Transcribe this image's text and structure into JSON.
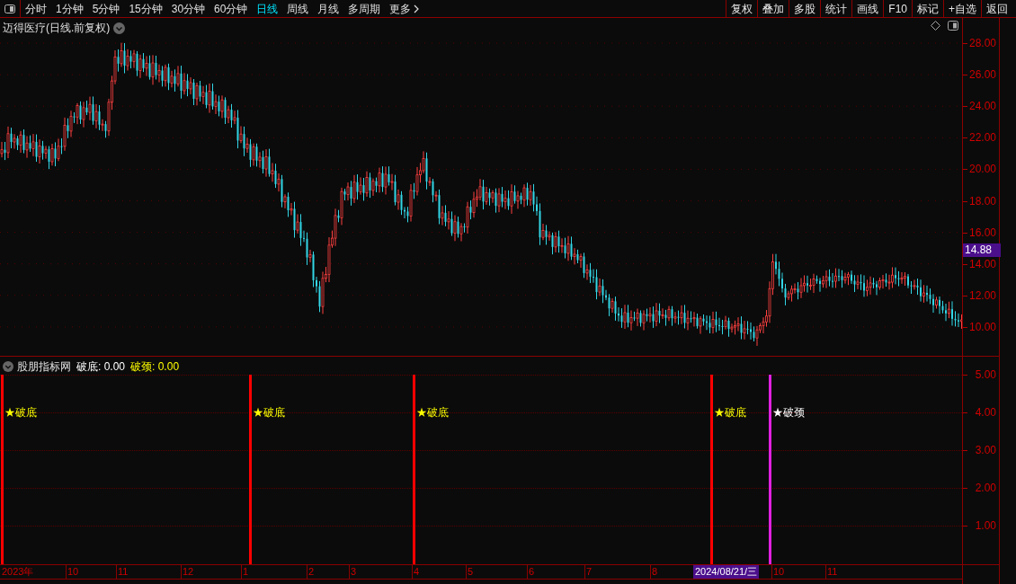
{
  "toolbar": {
    "periods": [
      {
        "label": "分时",
        "selected": false
      },
      {
        "label": "1分钟",
        "selected": false
      },
      {
        "label": "5分钟",
        "selected": false
      },
      {
        "label": "15分钟",
        "selected": false
      },
      {
        "label": "30分钟",
        "selected": false
      },
      {
        "label": "60分钟",
        "selected": false
      },
      {
        "label": "日线",
        "selected": true
      },
      {
        "label": "周线",
        "selected": false
      },
      {
        "label": "月线",
        "selected": false
      },
      {
        "label": "多周期",
        "selected": false
      }
    ],
    "more": "更多",
    "buttons": [
      "复权",
      "叠加",
      "多股",
      "统计",
      "画线",
      "F10",
      "标记",
      "+自选",
      "返回"
    ]
  },
  "price_chart": {
    "title": "迈得医疗(日线.前复权)",
    "y_ticks": [
      "28.00",
      "26.00",
      "24.00",
      "22.00",
      "20.00",
      "18.00",
      "16.00",
      "14.00",
      "12.00",
      "10.00"
    ],
    "current_price": "14.88"
  },
  "indicator": {
    "name": "股朋指标网",
    "values": [
      {
        "label": "破底:",
        "value": "0.00",
        "color": "#ffffff"
      },
      {
        "label": "破颈:",
        "value": "0.00",
        "color": "#ffff00"
      }
    ],
    "y_ticks": [
      "5.00",
      "4.00",
      "3.00",
      "2.00",
      "1.00"
    ],
    "signals": [
      {
        "kind": "bottom",
        "label": "★破底",
        "color": "#ff0000"
      },
      {
        "kind": "bottom",
        "label": "★破底",
        "color": "#ff0000"
      },
      {
        "kind": "bottom",
        "label": "★破底",
        "color": "#ff0000"
      },
      {
        "kind": "bottom",
        "label": "★破底",
        "color": "#ff0000"
      },
      {
        "kind": "neck",
        "label": "★破颈",
        "color": "#e020e0"
      }
    ]
  },
  "date_axis": {
    "labels": [
      "2023年",
      "10",
      "11",
      "12",
      "1",
      "2",
      "3",
      "4",
      "5",
      "6",
      "7",
      "8",
      "10",
      "11"
    ],
    "cursor_date": "2024/08/21/三"
  }
}
